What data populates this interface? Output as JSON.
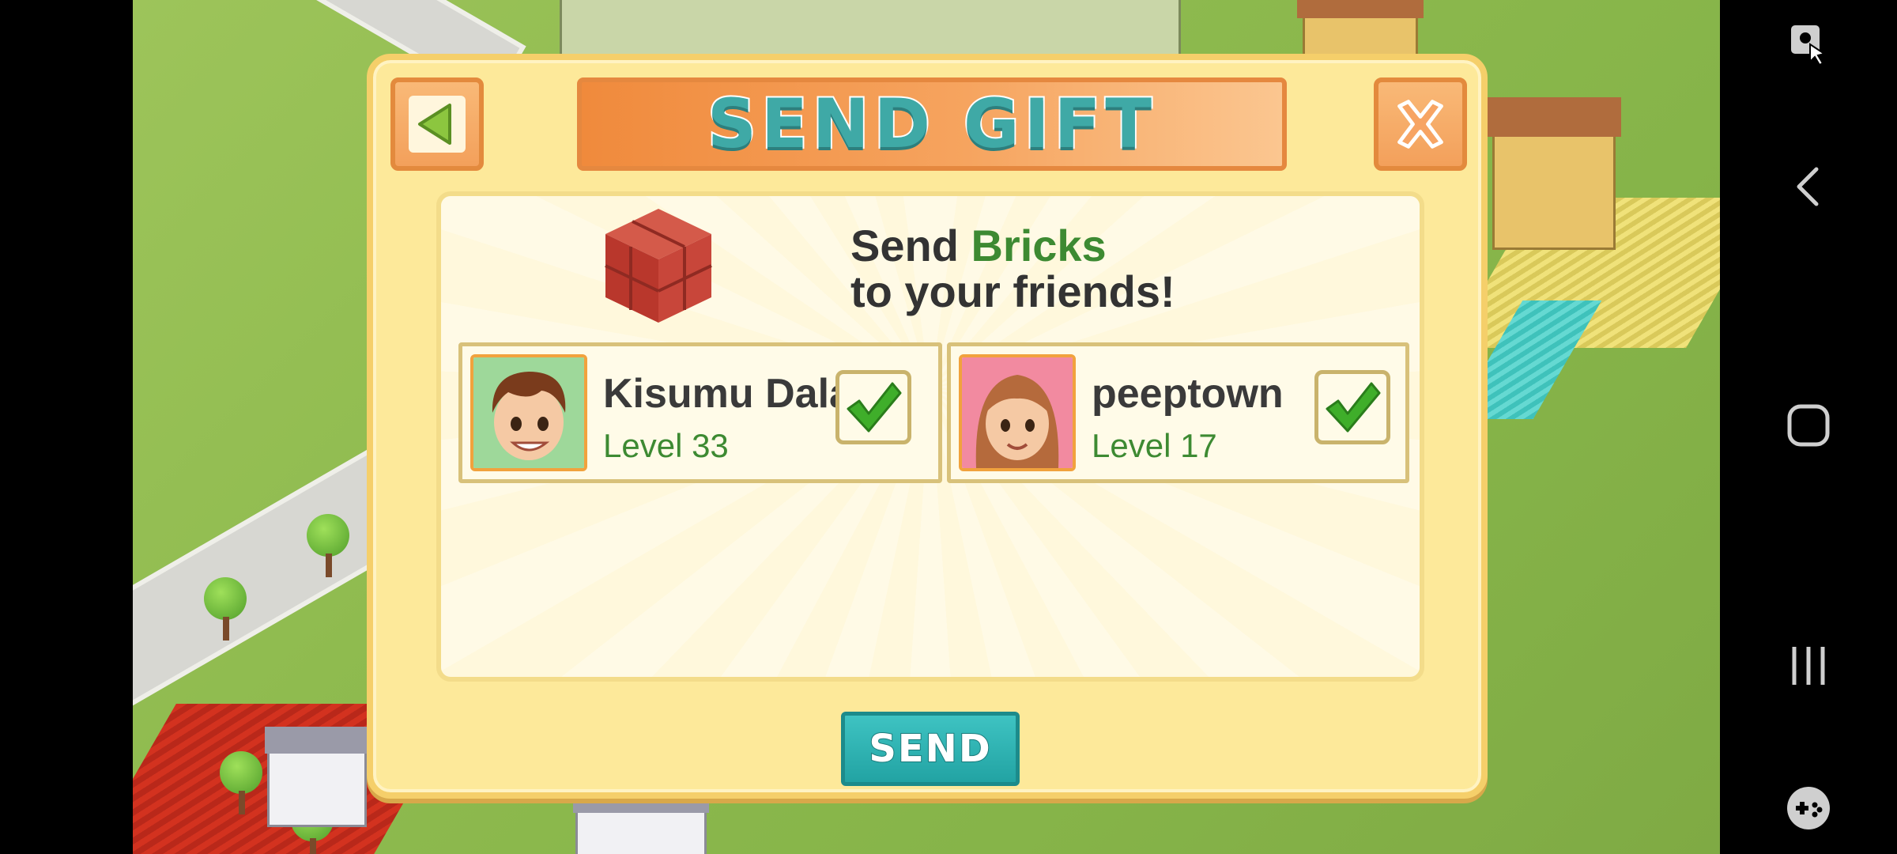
{
  "dialog": {
    "title": "SEND GIFT",
    "back_icon": "triangle-left-icon",
    "close_icon": "close-x-icon",
    "headline_prefix": "Send ",
    "headline_item": "Bricks",
    "headline_suffix": "to your friends!",
    "gift_icon": "brick-stack-icon",
    "send_label": "SEND",
    "friends": [
      {
        "name": "Kisumu Dala",
        "level": "Level 33",
        "avatar": "boy-avatar",
        "checked": true
      },
      {
        "name": "peeptown",
        "level": "Level 17",
        "avatar": "girl-avatar",
        "checked": true
      }
    ]
  },
  "system_nav": {
    "items": [
      "screen-pin-icon",
      "back-chevron-icon",
      "home-square-icon",
      "recents-icon",
      "game-tools-icon"
    ]
  },
  "colors": {
    "dialog_bg": "#fde99a",
    "title_text": "#3fa9a6",
    "accent_orange": "#f3a05b",
    "level_green": "#3d8a32",
    "send_button": "#2bb4b3"
  }
}
